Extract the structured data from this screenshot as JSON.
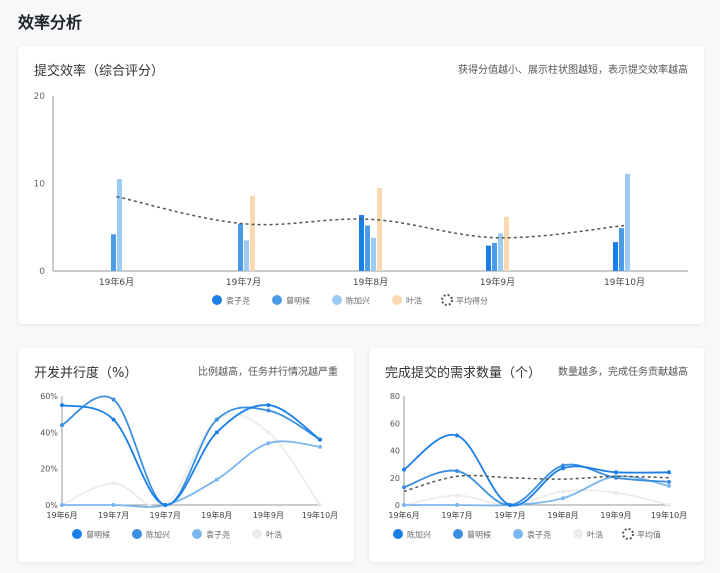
{
  "page": {
    "title": "效率分析"
  },
  "colors": {
    "yuanziyao": "#1a7fe6",
    "zengmingyou": "#4a9be8",
    "chenjiaxing": "#9ccbf5",
    "yehao": "#fad9b0",
    "yehao_line": "#ececec",
    "average": "#555555"
  },
  "card1": {
    "title": "提交效率（综合评分）",
    "subtitle": "获得分值越小、展示柱状图越短，表示提交效率越高"
  },
  "card2": {
    "title": "开发并行度（%）",
    "subtitle": "比例越高，任务并行情况越严重"
  },
  "card3": {
    "title": "完成提交的需求数量（个）",
    "subtitle": "数量越多，完成任务贡献越高"
  },
  "chart_data": [
    {
      "type": "bar",
      "categories": [
        "19年6月",
        "19年7月",
        "19年8月",
        "19年9月",
        "19年10月"
      ],
      "ylim": [
        0,
        20
      ],
      "yticks": [
        0,
        10,
        20
      ],
      "legend_position": "bottom",
      "series": [
        {
          "name": "袁子尧",
          "values": [
            0,
            0,
            6.4,
            2.9,
            3.3
          ],
          "color": "#1a7fe6"
        },
        {
          "name": "曾明候",
          "values": [
            4.2,
            5.4,
            5.2,
            3.2,
            4.9
          ],
          "color": "#4a9be8"
        },
        {
          "name": "陈加兴",
          "values": [
            10.5,
            3.5,
            3.8,
            4.3,
            11.1
          ],
          "color": "#9ccbf5"
        },
        {
          "name": "叶浩",
          "values": [
            0,
            8.6,
            9.5,
            6.2,
            0
          ],
          "color": "#fad9b0"
        }
      ],
      "average": {
        "name": "平均得分",
        "values": [
          8.5,
          5.4,
          5.9,
          3.8,
          5.2
        ]
      }
    },
    {
      "type": "line",
      "categories": [
        "19年6月",
        "19年7月",
        "19年7月",
        "19年8月",
        "19年9月",
        "19年10月"
      ],
      "ylim": [
        0,
        60
      ],
      "yticks": [
        "0%",
        "20%",
        "40%",
        "60%"
      ],
      "legend_position": "bottom",
      "series": [
        {
          "name": "曾明候",
          "values": [
            55,
            47,
            0,
            40,
            55,
            36
          ],
          "color": "#1a7fe6"
        },
        {
          "name": "陈加兴",
          "values": [
            44,
            58,
            0,
            47,
            52,
            36
          ],
          "color": "#3b8fe0"
        },
        {
          "name": "袁子尧",
          "values": [
            0,
            0,
            0,
            14,
            34,
            32
          ],
          "color": "#7bb7ee"
        },
        {
          "name": "叶浩",
          "values": [
            0,
            12,
            0,
            47,
            40,
            0
          ],
          "color": "#ececec"
        }
      ]
    },
    {
      "type": "line",
      "categories": [
        "19年6月",
        "19年7月",
        "19年7月",
        "19年8月",
        "19年9月",
        "19年10月"
      ],
      "ylim": [
        0,
        80
      ],
      "yticks": [
        0,
        20,
        40,
        60,
        80
      ],
      "legend_position": "bottom",
      "series": [
        {
          "name": "陈加兴",
          "values": [
            26,
            51,
            0,
            27,
            24,
            24
          ],
          "color": "#1a7fe6"
        },
        {
          "name": "曾明候",
          "values": [
            13,
            25,
            0,
            29,
            20,
            17
          ],
          "color": "#3b8fe0"
        },
        {
          "name": "袁子尧",
          "values": [
            0,
            0,
            0,
            5,
            21,
            14
          ],
          "color": "#7bb7ee"
        },
        {
          "name": "叶浩",
          "values": [
            0,
            7,
            0,
            10,
            9,
            0
          ],
          "color": "#ececec"
        }
      ],
      "average": {
        "name": "平均值",
        "values": [
          10,
          21,
          20,
          19,
          21,
          20
        ]
      }
    }
  ]
}
